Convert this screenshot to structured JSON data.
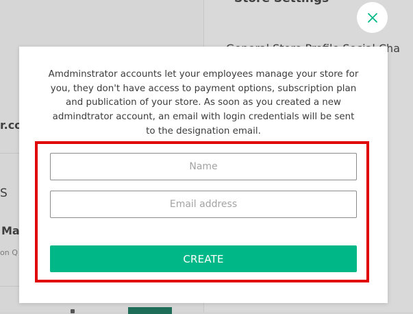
{
  "background": {
    "store_settings_title": "Store Settings",
    "tabs_text": "General  Store Profile  Social Cha",
    "domain_fragment": "r.com",
    "section_fragment": "S",
    "item_fragment": "Ma",
    "item_sub_fragment": "on Q"
  },
  "modal": {
    "description": "Amdminstrator accounts let your employees manage your store for you, they don't have access to payment options, subscription plan and publication of your store. As soon as you created a new admindtrator account, an email with login credentials will be sent to the designation email.",
    "name_placeholder": "Name",
    "email_placeholder": "Email address",
    "create_label": "CREATE",
    "close_icon": "close-icon"
  },
  "colors": {
    "accent": "#00b887",
    "highlight": "#e00000",
    "close_icon": "#00b887"
  }
}
